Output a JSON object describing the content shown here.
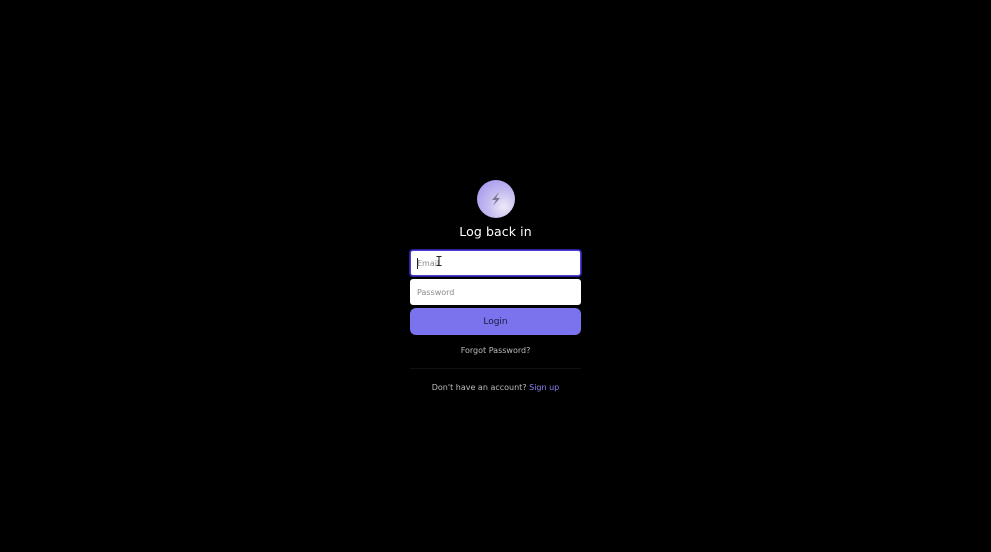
{
  "colors": {
    "background": "#000000",
    "accent": "#7b72ee",
    "link": "#8a80f5",
    "focus_border": "#4b3fd1"
  },
  "logo": {
    "icon": "lightning-bolt-icon"
  },
  "title": "Log back in",
  "form": {
    "email": {
      "placeholder": "Email",
      "value": ""
    },
    "password": {
      "placeholder": "Password",
      "value": ""
    },
    "login_label": "Login",
    "forgot_label": "Forgot Password?"
  },
  "footer": {
    "prompt": "Don't have an account?",
    "signup_label": "Sign up"
  }
}
